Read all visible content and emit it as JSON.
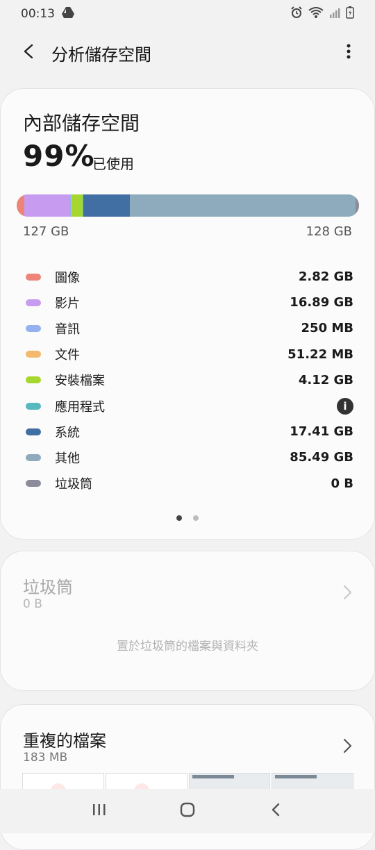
{
  "status": {
    "time": "00:13"
  },
  "header": {
    "title": "分析儲存空間"
  },
  "storage": {
    "title": "內部儲存空間",
    "percent": "99%",
    "used_label": "已使用",
    "used_amount": "127 GB",
    "total": "128 GB",
    "usage_fraction": 0.99,
    "categories": [
      {
        "label": "圖像",
        "value": "2.82 GB",
        "color": "#ee8478"
      },
      {
        "label": "影片",
        "value": "16.89 GB",
        "color": "#c79cf0"
      },
      {
        "label": "音訊",
        "value": "250 MB",
        "color": "#95b2ef"
      },
      {
        "label": "文件",
        "value": "51.22 MB",
        "color": "#f3b96d"
      },
      {
        "label": "安裝檔案",
        "value": "4.12 GB",
        "color": "#a6d72f"
      },
      {
        "label": "應用程式",
        "value": "",
        "info_icon": "info-icon",
        "color": "#57b8bd"
      },
      {
        "label": "系統",
        "value": "17.41 GB",
        "color": "#416fa4"
      },
      {
        "label": "其他",
        "value": "85.49 GB",
        "color": "#8eaabd"
      },
      {
        "label": "垃圾筒",
        "value": "0 B",
        "color": "#8b8b99"
      }
    ],
    "info_glyph": "i"
  },
  "trash": {
    "title": "垃圾筒",
    "size": "0 B",
    "description": "置於垃圾筒的檔案與資料夾"
  },
  "duplicates": {
    "title": "重複的檔案",
    "size": "183 MB"
  }
}
